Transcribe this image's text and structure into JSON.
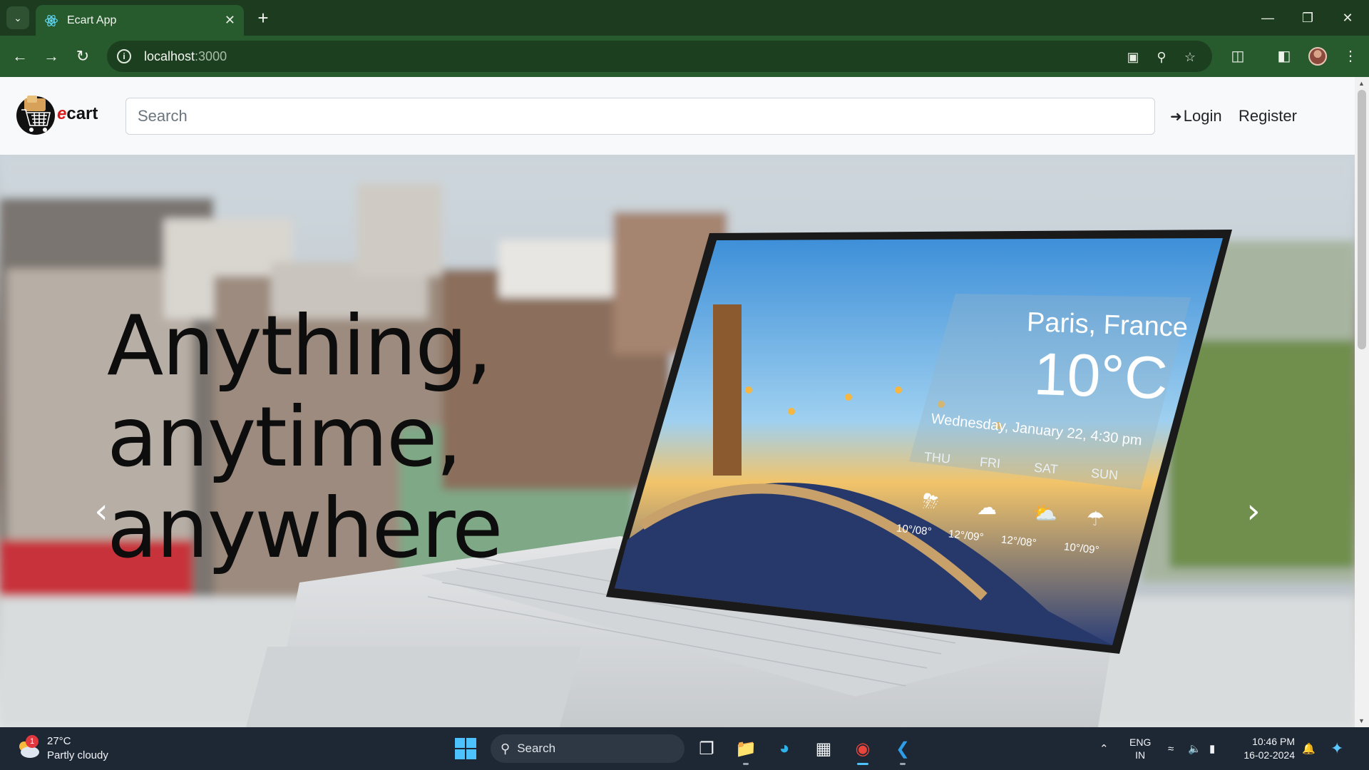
{
  "browser": {
    "tab_title": "Ecart App",
    "url_host": "localhost",
    "url_port": ":3000"
  },
  "navbar": {
    "logo_text_e": "e",
    "logo_text_rest": "cart",
    "search_placeholder": "Search",
    "login_label": "Login",
    "register_label": "Register"
  },
  "hero": {
    "title_line1": "Anything, anytime,",
    "title_line2": "anywhere",
    "screen": {
      "city": "Paris, France",
      "temperature": "10°C",
      "date": "Wednesday, January 22, 4:30 pm",
      "days": [
        "THU",
        "FRI",
        "SAT",
        "SUN"
      ],
      "temps": [
        "10°/08°",
        "12°/09°",
        "12°/08°",
        "10°/09°"
      ]
    }
  },
  "taskbar": {
    "weather_temp": "27°C",
    "weather_desc": "Partly cloudy",
    "weather_badge": "1",
    "search_label": "Search",
    "lang_1": "ENG",
    "lang_2": "IN",
    "time": "10:46 PM",
    "date": "16-02-2024"
  },
  "colors": {
    "chrome_dark": "#1c3b1f",
    "chrome_toolbar": "#275a2c",
    "navbar_bg": "#f8f9fa",
    "taskbar_bg": "#1e2734",
    "accent": "#4cc2ff"
  }
}
